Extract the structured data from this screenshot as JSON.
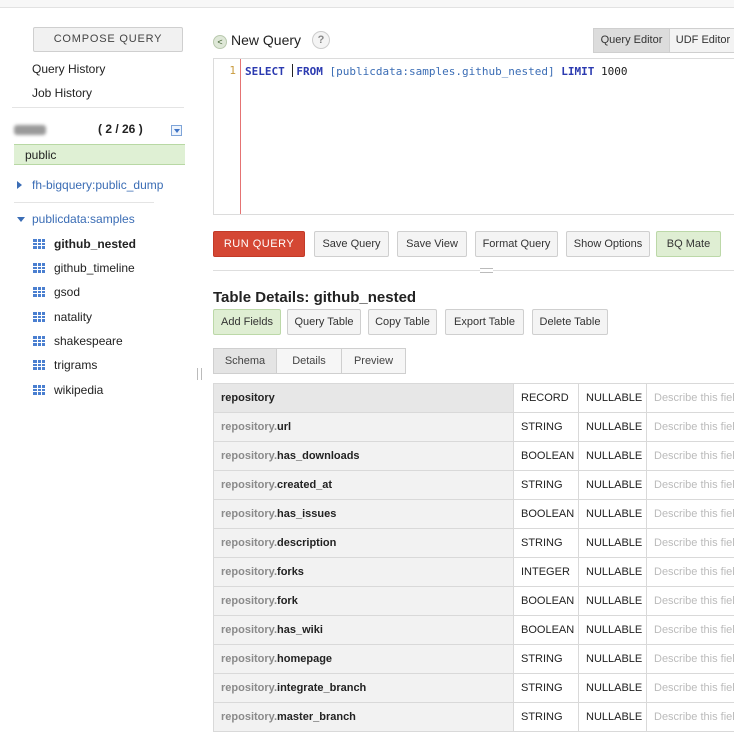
{
  "sidebar": {
    "compose_label": "COMPOSE QUERY",
    "query_history": "Query History",
    "job_history": "Job History",
    "project_count": "( 2 / 26 )",
    "public_label": "public",
    "datasets": [
      {
        "label": "fh-bigquery:public_dump"
      },
      {
        "label": "publicdata:samples"
      }
    ],
    "tables": [
      "github_nested",
      "github_timeline",
      "gsod",
      "natality",
      "shakespeare",
      "trigrams",
      "wikipedia"
    ]
  },
  "header": {
    "back": "<",
    "title": "New Query",
    "help": "?",
    "tabs": [
      "Query Editor",
      "UDF Editor"
    ]
  },
  "editor": {
    "line_number": "1",
    "kw_select": "SELECT",
    "kw_from": "FROM",
    "table_ref": "[publicdata:samples.github_nested]",
    "kw_limit": "LIMIT",
    "limit_value": "1000"
  },
  "actions": {
    "run": "RUN QUERY",
    "save_query": "Save Query",
    "save_view": "Save View",
    "format_query": "Format Query",
    "show_options": "Show Options",
    "bq_mate": "BQ Mate"
  },
  "details": {
    "title": "Table Details: github_nested",
    "buttons": [
      "Add Fields",
      "Query Table",
      "Copy Table",
      "Export Table",
      "Delete Table"
    ],
    "tabs": [
      "Schema",
      "Details",
      "Preview"
    ],
    "desc_placeholder": "Describe this field",
    "fields": [
      {
        "prefix": "",
        "name": "repository",
        "type": "RECORD",
        "mode": "NULLABLE"
      },
      {
        "prefix": "repository.",
        "name": "url",
        "type": "STRING",
        "mode": "NULLABLE"
      },
      {
        "prefix": "repository.",
        "name": "has_downloads",
        "type": "BOOLEAN",
        "mode": "NULLABLE"
      },
      {
        "prefix": "repository.",
        "name": "created_at",
        "type": "STRING",
        "mode": "NULLABLE"
      },
      {
        "prefix": "repository.",
        "name": "has_issues",
        "type": "BOOLEAN",
        "mode": "NULLABLE"
      },
      {
        "prefix": "repository.",
        "name": "description",
        "type": "STRING",
        "mode": "NULLABLE"
      },
      {
        "prefix": "repository.",
        "name": "forks",
        "type": "INTEGER",
        "mode": "NULLABLE"
      },
      {
        "prefix": "repository.",
        "name": "fork",
        "type": "BOOLEAN",
        "mode": "NULLABLE"
      },
      {
        "prefix": "repository.",
        "name": "has_wiki",
        "type": "BOOLEAN",
        "mode": "NULLABLE"
      },
      {
        "prefix": "repository.",
        "name": "homepage",
        "type": "STRING",
        "mode": "NULLABLE"
      },
      {
        "prefix": "repository.",
        "name": "integrate_branch",
        "type": "STRING",
        "mode": "NULLABLE"
      },
      {
        "prefix": "repository.",
        "name": "master_branch",
        "type": "STRING",
        "mode": "NULLABLE"
      }
    ]
  },
  "colors": {
    "run_button": "#d44734",
    "selected_green": "#dff0d4",
    "link_blue": "#3b6db5",
    "keyword_blue": "#2b3ab0"
  },
  "icons": {
    "table": "table-grid-icon",
    "collapsed": "triangle-right-icon",
    "expanded": "triangle-down-icon",
    "dropdown": "chevron-down-icon",
    "help": "help-icon",
    "back": "back-icon"
  }
}
